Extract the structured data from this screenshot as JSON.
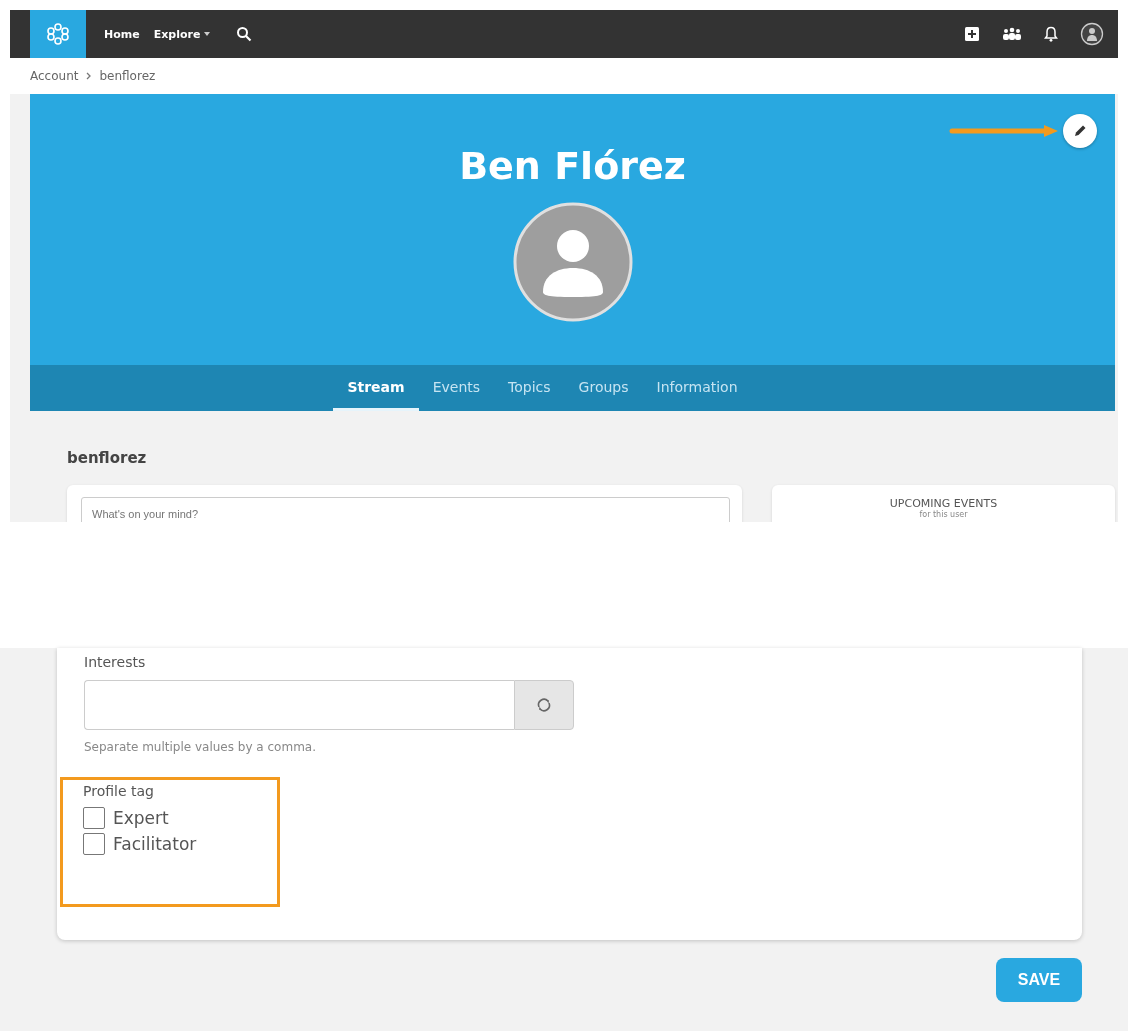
{
  "navbar": {
    "items": [
      {
        "label": "Home",
        "kind": "link"
      },
      {
        "label": "Explore",
        "kind": "dropdown"
      }
    ]
  },
  "breadcrumb": [
    "Account",
    "benflorez"
  ],
  "profile": {
    "name": "Ben Flórez",
    "tabs": [
      {
        "label": "Stream",
        "selected": true
      },
      {
        "label": "Events",
        "selected": false
      },
      {
        "label": "Topics",
        "selected": false
      },
      {
        "label": "Groups",
        "selected": false
      },
      {
        "label": "Information",
        "selected": false
      }
    ]
  },
  "stream": {
    "username": "benflorez",
    "post_placeholder": "What's on your mind?",
    "events_title": "UPCOMING EVENTS",
    "events_subtitle": "for this user"
  },
  "form": {
    "interests": {
      "label": "Interests",
      "help": "Separate multiple values by a comma."
    },
    "profile_tag": {
      "label": "Profile tag",
      "options": [
        {
          "label": "Expert",
          "checked": false
        },
        {
          "label": "Facilitator",
          "checked": false
        }
      ]
    },
    "save": "SAVE"
  }
}
